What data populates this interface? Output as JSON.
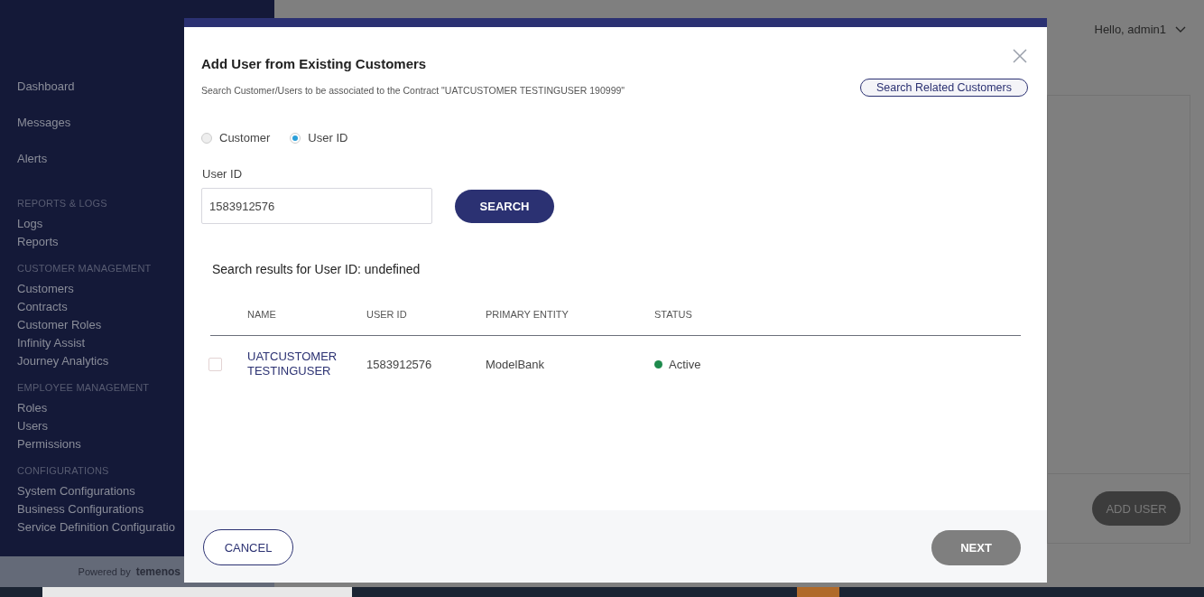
{
  "sidebar": {
    "items": [
      {
        "kind": "item",
        "label": "Dashboard",
        "gap": true
      },
      {
        "kind": "item",
        "label": "Messages",
        "gap": true
      },
      {
        "kind": "item",
        "label": "Alerts",
        "gap": true
      },
      {
        "kind": "heading",
        "label": "REPORTS & LOGS"
      },
      {
        "kind": "item",
        "label": "Logs"
      },
      {
        "kind": "item",
        "label": "Reports"
      },
      {
        "kind": "heading",
        "label": "CUSTOMER MANAGEMENT"
      },
      {
        "kind": "item",
        "label": "Customers"
      },
      {
        "kind": "item",
        "label": "Contracts"
      },
      {
        "kind": "item",
        "label": "Customer Roles"
      },
      {
        "kind": "item",
        "label": "Infinity Assist"
      },
      {
        "kind": "item",
        "label": "Journey Analytics"
      },
      {
        "kind": "heading",
        "label": "EMPLOYEE MANAGEMENT"
      },
      {
        "kind": "item",
        "label": "Roles"
      },
      {
        "kind": "item",
        "label": "Users"
      },
      {
        "kind": "item",
        "label": "Permissions"
      },
      {
        "kind": "heading",
        "label": "CONFIGURATIONS"
      },
      {
        "kind": "item",
        "label": "System Configurations"
      },
      {
        "kind": "item",
        "label": "Business Configurations"
      },
      {
        "kind": "item",
        "label": "Service Definition Configuratio"
      }
    ],
    "footer": {
      "prefix": "Powered by",
      "brand": "temenos"
    }
  },
  "header": {
    "greeting": "Hello, admin1"
  },
  "background": {
    "button": "ADD USER"
  },
  "dialog": {
    "title": "Add User from Existing Customers",
    "subtitle": "Search Customer/Users to be associated to the Contract \"UATCUSTOMER TESTINGUSER 190999\"",
    "related_button": "Search Related Customers",
    "search_by": [
      {
        "label": "Customer",
        "selected": false
      },
      {
        "label": "User ID",
        "selected": true
      }
    ],
    "field": {
      "label": "User ID",
      "value": "1583912576"
    },
    "search_button": "SEARCH",
    "results_heading": "Search results for User ID: undefined",
    "table": {
      "columns": [
        "NAME",
        "USER ID",
        "PRIMARY ENTITY",
        "STATUS"
      ],
      "rows": [
        {
          "checked": false,
          "name": "UATCUSTOMER TESTINGUSER",
          "user_id": "1583912576",
          "entity": "ModelBank",
          "status": "Active",
          "color": "#1e8a4c"
        }
      ]
    },
    "buttons": {
      "cancel": "CANCEL",
      "next": "NEXT"
    }
  }
}
